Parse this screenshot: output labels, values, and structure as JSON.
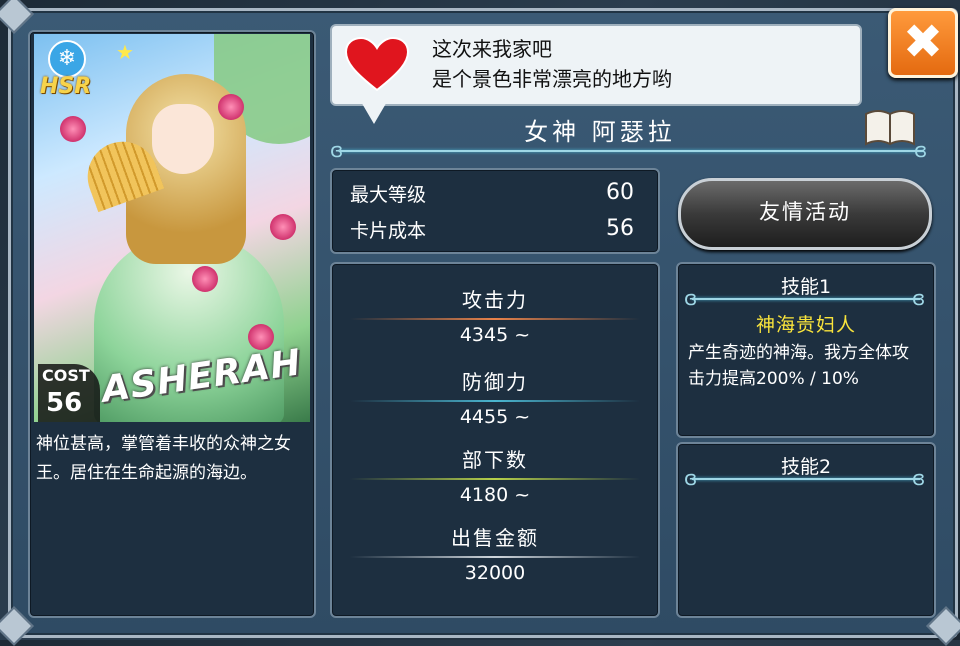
{
  "card": {
    "rarity_badge": "HSR",
    "element_icon": "snowflake-icon",
    "name_art": "ASHERAH",
    "cost_label": "COST",
    "cost_value": "56",
    "description": "神位甚高，掌管着丰收的众神之女王。居住在生命起源的海边。"
  },
  "dialog": {
    "line1": "这次来我家吧",
    "line2": "是个景色非常漂亮的地方哟"
  },
  "character_title": "女神 阿瑟拉",
  "summary": {
    "max_level_label": "最大等级",
    "max_level_value": "60",
    "card_cost_label": "卡片成本",
    "card_cost_value": "56"
  },
  "friend_button_label": "友情活动",
  "stats": {
    "attack_label": "攻击力",
    "attack_value": "4345 ~",
    "defense_label": "防御力",
    "defense_value": "4455 ~",
    "subordinates_label": "部下数",
    "subordinates_value": "4180 ~",
    "sell_label": "出售金额",
    "sell_value": "32000"
  },
  "skills": {
    "skill1_header": "技能1",
    "skill1_name": "神海贵妇人",
    "skill1_desc": "产生奇迹的神海。我方全体攻击力提高200% / 10%",
    "skill2_header": "技能2"
  },
  "close_button_label": "✖",
  "colors": {
    "accent_cyan": "#9fd7e6",
    "skill_name_yellow": "#f9e43c",
    "close_orange": "#e46a10"
  }
}
